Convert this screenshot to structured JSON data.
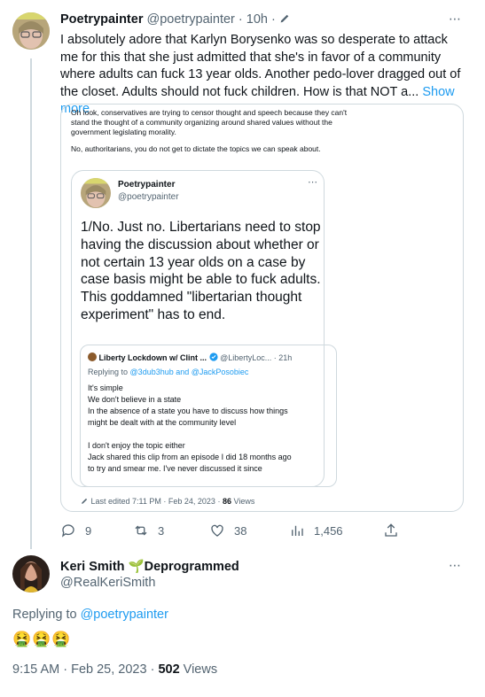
{
  "tweet1": {
    "author_name": "Poetrypainter",
    "author_handle": "@poetrypainter",
    "time_sep": "· 10h ·",
    "body": "I absolutely adore that Karlyn Borysenko was so desperate to attack me for this that she just admitted that she's in favor of a community where adults can fuck 13 year olds.  Another pedo-lover dragged out of the closet.  Adults should not fuck children.  How is that NOT a...",
    "show_more": "Show more",
    "quote": {
      "text1": "Oh look, conservatives are trying to censor thought and speech because they can't stand the thought of a community organizing around shared values without the government legislating morality.",
      "text2": "No, authoritarians, you do not get to dictate the topics we can speak about.",
      "inner": {
        "author_name": "Poetrypainter",
        "author_handle": "@poetrypainter",
        "body": "1/No.  Just no.  Libertarians need to stop having the discussion about whether or not certain 13 year olds on a case by case basis might be able to fuck adults.  This goddamned \"libertarian thought experiment\" has to end.",
        "nested": {
          "author_name": "Liberty Lockdown w/ Clint ...",
          "author_handle": "@LibertyLoc...",
          "time": "· 21h",
          "replying_prefix": "Replying to",
          "replying_handles": "@3dub3hub and @JackPosobiec",
          "lines": [
            "It's simple",
            "We don't believe in a state",
            "In the absence of a state you have to discuss how things",
            "might be dealt with at the community level",
            "",
            "I don't enjoy the topic either",
            "Jack shared this clip from an episode I did 18 months ago",
            "to try and smear me. I've never discussed it since"
          ]
        }
      },
      "edited_label": "Last edited 7:11 PM · Feb 24, 2023 ·",
      "views_count": "86",
      "views_label": "Views"
    },
    "actions": {
      "replies": "9",
      "retweets": "3",
      "likes": "38",
      "views": "1,456"
    }
  },
  "tweet2": {
    "author_name": "Keri Smith",
    "author_name_suffix": "Deprogrammed",
    "sprout_glyph": "🌱",
    "author_handle": "@RealKeriSmith",
    "replying_prefix": "Replying to",
    "replying_handle": "@poetrypainter",
    "emojis": "🤮🤮🤮",
    "timestamp": "9:15 AM · Feb 25, 2023 ·",
    "views_count": "502",
    "views_label": "Views"
  },
  "icons": {
    "more": "⋯"
  },
  "colors": {
    "link": "#1d9bf0",
    "muted": "#536471",
    "border": "#cfd9de",
    "verified": "#1d9bf0"
  }
}
